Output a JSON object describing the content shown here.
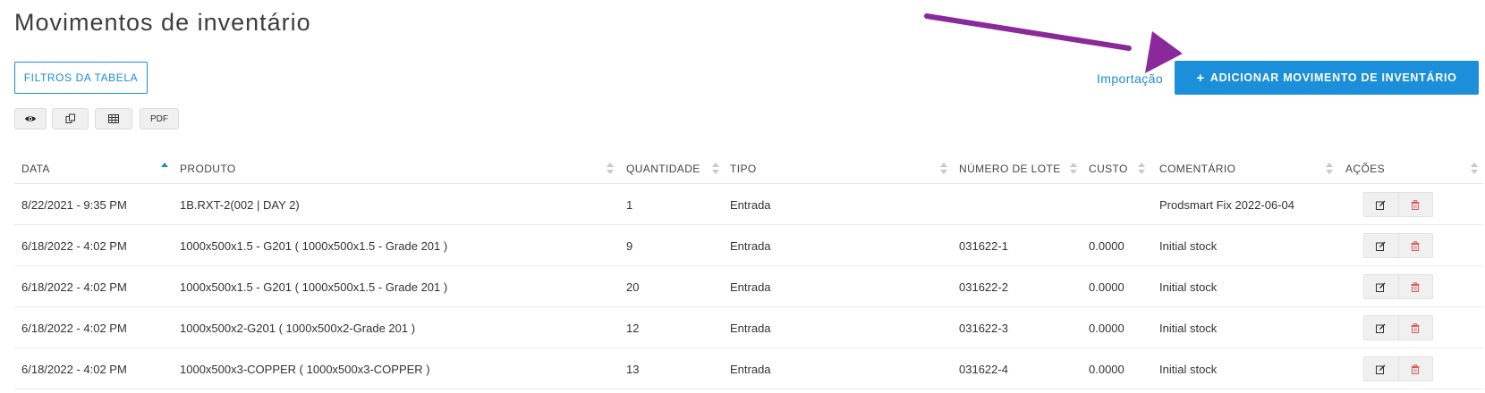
{
  "page": {
    "title": "Movimentos de inventário"
  },
  "toolbar": {
    "filters_label": "FILTROS DA TABELA",
    "import_label": "Importação",
    "add_label": "ADICIONAR MOVIMENTO DE INVENTÁRIO",
    "pdf_label": "PDF"
  },
  "icons": {
    "view": "eye-icon",
    "copy": "copy-icon",
    "excel": "spreadsheet-icon",
    "edit": "edit-icon",
    "delete": "trash-icon",
    "add": "plus-icon"
  },
  "colors": {
    "accent": "#1a8dd6",
    "button": "#1b8fd9",
    "delete": "#e05a5a",
    "annotation_arrow": "#8a2a9a"
  },
  "table": {
    "columns": [
      "DATA",
      "PRODUTO",
      "QUANTIDADE",
      "TIPO",
      "NÚMERO DE LOTE",
      "CUSTO",
      "COMENTÁRIO",
      "AÇÕES"
    ],
    "sorted_column": "DATA",
    "sort_direction": "ascending",
    "rows": [
      [
        "8/22/2021 - 9:35 PM",
        "1B.RXT-2(002 | DAY 2)",
        "1",
        "Entrada",
        "",
        "",
        "Prodsmart Fix 2022-06-04"
      ],
      [
        "6/18/2022 - 4:02 PM",
        "1000x500x1.5 - G201 ( 1000x500x1.5 - Grade 201 )",
        "9",
        "Entrada",
        "031622-1",
        "0.0000",
        "Initial stock"
      ],
      [
        "6/18/2022 - 4:02 PM",
        "1000x500x1.5 - G201 ( 1000x500x1.5 - Grade 201 )",
        "20",
        "Entrada",
        "031622-2",
        "0.0000",
        "Initial stock"
      ],
      [
        "6/18/2022 - 4:02 PM",
        "1000x500x2-G201 ( 1000x500x2-Grade 201 )",
        "12",
        "Entrada",
        "031622-3",
        "0.0000",
        "Initial stock"
      ],
      [
        "6/18/2022 - 4:02 PM",
        "1000x500x3-COPPER ( 1000x500x3-COPPER )",
        "13",
        "Entrada",
        "031622-4",
        "0.0000",
        "Initial stock"
      ]
    ]
  }
}
